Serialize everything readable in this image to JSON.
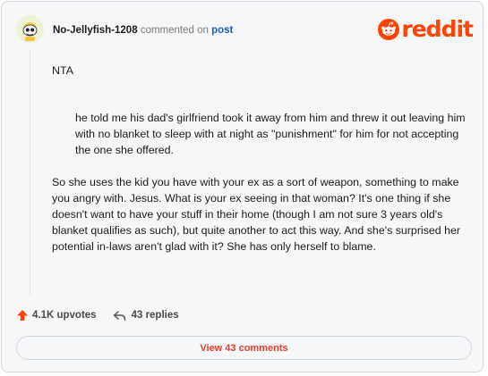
{
  "header": {
    "username": "No-Jellyfish-1208",
    "commented_on": "commented on",
    "post_link": "post",
    "brand": "reddit"
  },
  "comment": {
    "opening": "NTA",
    "quote": "he told me his dad's girlfriend took it away from him and threw it out leaving him with no blanket to sleep with at night as \"punishment\" for him for not accepting the one she offered.",
    "paragraph": "So she uses the kid you have with your ex as a sort of weapon, something to make you angry with. Jesus. What is your ex seeing in that woman? It's one thing if she doesn't want to have your stuff in their home (though I am not sure 3 years old's blanket qualifies as such), but quite another to act this way. And she's surprised her potential in-laws aren't glad with it? She has only herself to blame."
  },
  "actions": {
    "upvotes": "4.1K upvotes",
    "replies": "43 replies"
  },
  "footer": {
    "view_comments": "View 43 comments"
  },
  "colors": {
    "brand": "#ff4500",
    "link": "#1a5fc6",
    "view_button_text": "#e0402b"
  }
}
